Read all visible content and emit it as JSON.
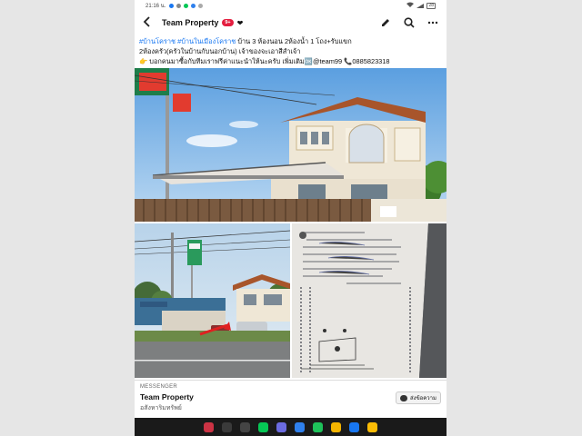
{
  "statusbar": {
    "time": "21:16 น.",
    "battery": "28"
  },
  "header": {
    "title": "Team Property",
    "badge": "9+"
  },
  "caption": {
    "tags": "#บ้านโคราช #บ้านในเมืองโคราช",
    "line1_text": " บ้าน 3 ห้องนอน 2ห้องน้ำ 1 โถง+รับแขก",
    "line2": "2ห้องครัว(ครัวในบ้านกับนอกบ้าน) เจ้าของจะเอาสีสำเจ้า",
    "line3": "👉 บอกคนมาซื้อกับทีมเราฟรีค่าแนะนำให้นะครับ เพิ่มเติม🆗@team99 📞0885823318"
  },
  "messenger": {
    "label": "MESSENGER",
    "name": "Team Property",
    "sub": "อสังหาริมทรัพย์",
    "button": "ส่งข้อความ"
  },
  "dock": {
    "apps": [
      {
        "icon": "apps-grid-icon",
        "color": "#cc3344"
      },
      {
        "icon": "messages-icon",
        "color": "#3a3a3a"
      },
      {
        "icon": "camera-icon",
        "color": "#444444"
      },
      {
        "icon": "line-icon",
        "color": "#06c755"
      },
      {
        "icon": "settings-icon",
        "color": "#6b6be0"
      },
      {
        "icon": "play-store-icon",
        "color": "#2f80ed"
      },
      {
        "icon": "facebook-messenger-icon",
        "color": "#1ec25a"
      },
      {
        "icon": "chrome-icon",
        "color": "#f4b400"
      },
      {
        "icon": "facebook-icon",
        "color": "#1877f2"
      },
      {
        "icon": "photos-icon",
        "color": "#fbbc05"
      }
    ]
  }
}
